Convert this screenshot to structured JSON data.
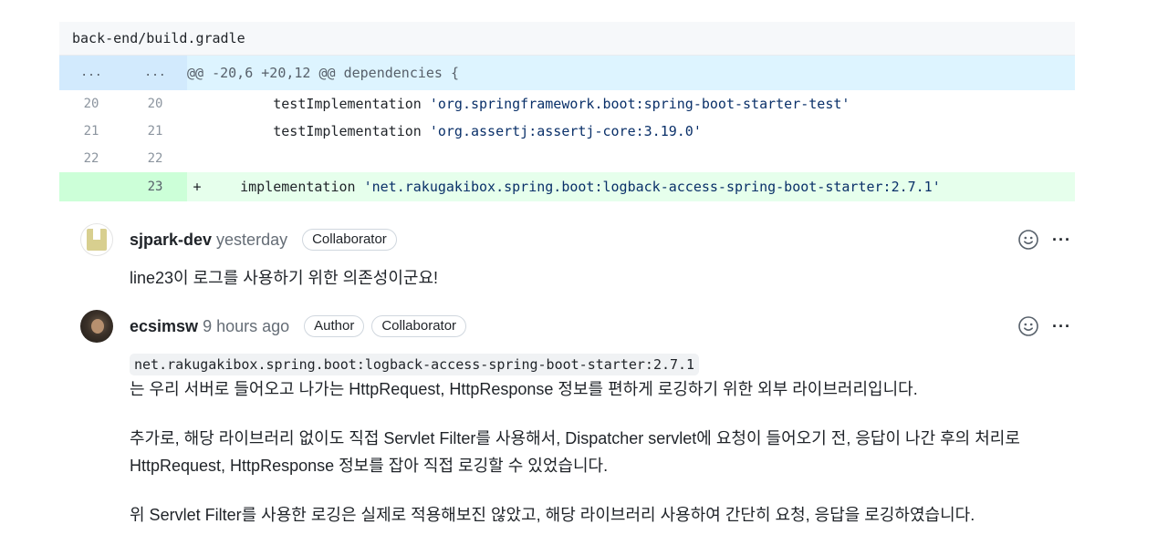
{
  "diff": {
    "file_path": "back-end/build.gradle",
    "hunk": {
      "old": "...",
      "new": "...",
      "header": "@@ -20,6 +20,12 @@ dependencies {"
    },
    "lines": [
      {
        "old": "20",
        "new": "20",
        "sign": "",
        "keyword": "        testImplementation ",
        "string": "'org.springframework.boot:spring-boot-starter-test'"
      },
      {
        "old": "21",
        "new": "21",
        "sign": "",
        "keyword": "        testImplementation ",
        "string": "'org.assertj:assertj-core:3.19.0'"
      },
      {
        "old": "22",
        "new": "22",
        "sign": "",
        "keyword": "",
        "string": ""
      },
      {
        "old": "",
        "new": "23",
        "sign": "+",
        "keyword": "    implementation ",
        "string": "'net.rakugakibox.spring.boot:logback-access-spring-boot-starter:2.7.1'"
      }
    ]
  },
  "comments": [
    {
      "author": "sjpark-dev",
      "time": "yesterday",
      "badges": [
        "Collaborator"
      ],
      "body": [
        "line23이 로그를 사용하기 위한 의존성이군요!"
      ]
    },
    {
      "author": "ecsimsw",
      "time": "9 hours ago",
      "badges": [
        "Author",
        "Collaborator"
      ],
      "code": "net.rakugakibox.spring.boot:logback-access-spring-boot-starter:2.7.1",
      "body": [
        "는 우리 서버로 들어오고 나가는 HttpRequest, HttpResponse 정보를 편하게 로깅하기 위한 외부 라이브러리입니다.",
        "추가로, 해당 라이브러리 없이도 직접 Servlet Filter를 사용해서, Dispatcher servlet에 요청이 들어오기 전, 응답이 나간 후의 처리로",
        "HttpRequest, HttpResponse 정보를 잡아 직접 로깅할 수 있었습니다.",
        "위 Servlet Filter를 사용한 로깅은 실제로 적용해보진 않았고, 해당 라이브러리 사용하여 간단히 요청, 응답을 로깅하였습니다."
      ]
    }
  ],
  "icons": {
    "reaction": "smiley-icon",
    "more": "kebab-horizontal-icon"
  },
  "colors": {
    "hunk_bg": "#ddf4ff",
    "added_bg": "#e6ffec",
    "added_gutter": "#ccffd8",
    "string": "#0a3069"
  }
}
